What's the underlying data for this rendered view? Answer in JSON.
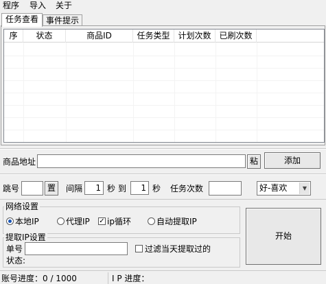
{
  "menu": [
    "程序",
    "导入",
    "关于"
  ],
  "tabs": [
    "任务查看",
    "事件提示"
  ],
  "table": {
    "columns": [
      "序",
      "状态",
      "商品ID",
      "任务类型",
      "计划次数",
      "已刷次数"
    ]
  },
  "product": {
    "label": "商品地址",
    "value": "",
    "paste_label": "粘",
    "add_label": "添加"
  },
  "params": {
    "jump_label": "跳号",
    "jump_value": "",
    "set_label": "置",
    "interval_label": "间隔",
    "interval_from": "1",
    "sec_label": "秒",
    "to_label": "到",
    "interval_to": "1",
    "sec_label2": "秒",
    "task_count_label": "任务次数",
    "task_count_value": "",
    "type_select": "好-喜欢"
  },
  "network": {
    "title": "网络设置",
    "options": [
      "本地IP",
      "代理IP"
    ],
    "selected": "本地IP",
    "ip_loop_label": "ip循环",
    "ip_loop_checked": true,
    "auto_fetch_label": "自动提取IP"
  },
  "fetch": {
    "title": "提取IP设置",
    "order_label": "单号",
    "order_value": "",
    "filter_label": "过滤当天提取过的",
    "filter_checked": false,
    "status_label": "状态:"
  },
  "start_label": "开始",
  "statusbar": {
    "account_progress": "账号进度：0 / 1000",
    "ip_progress": "I P 进度："
  }
}
